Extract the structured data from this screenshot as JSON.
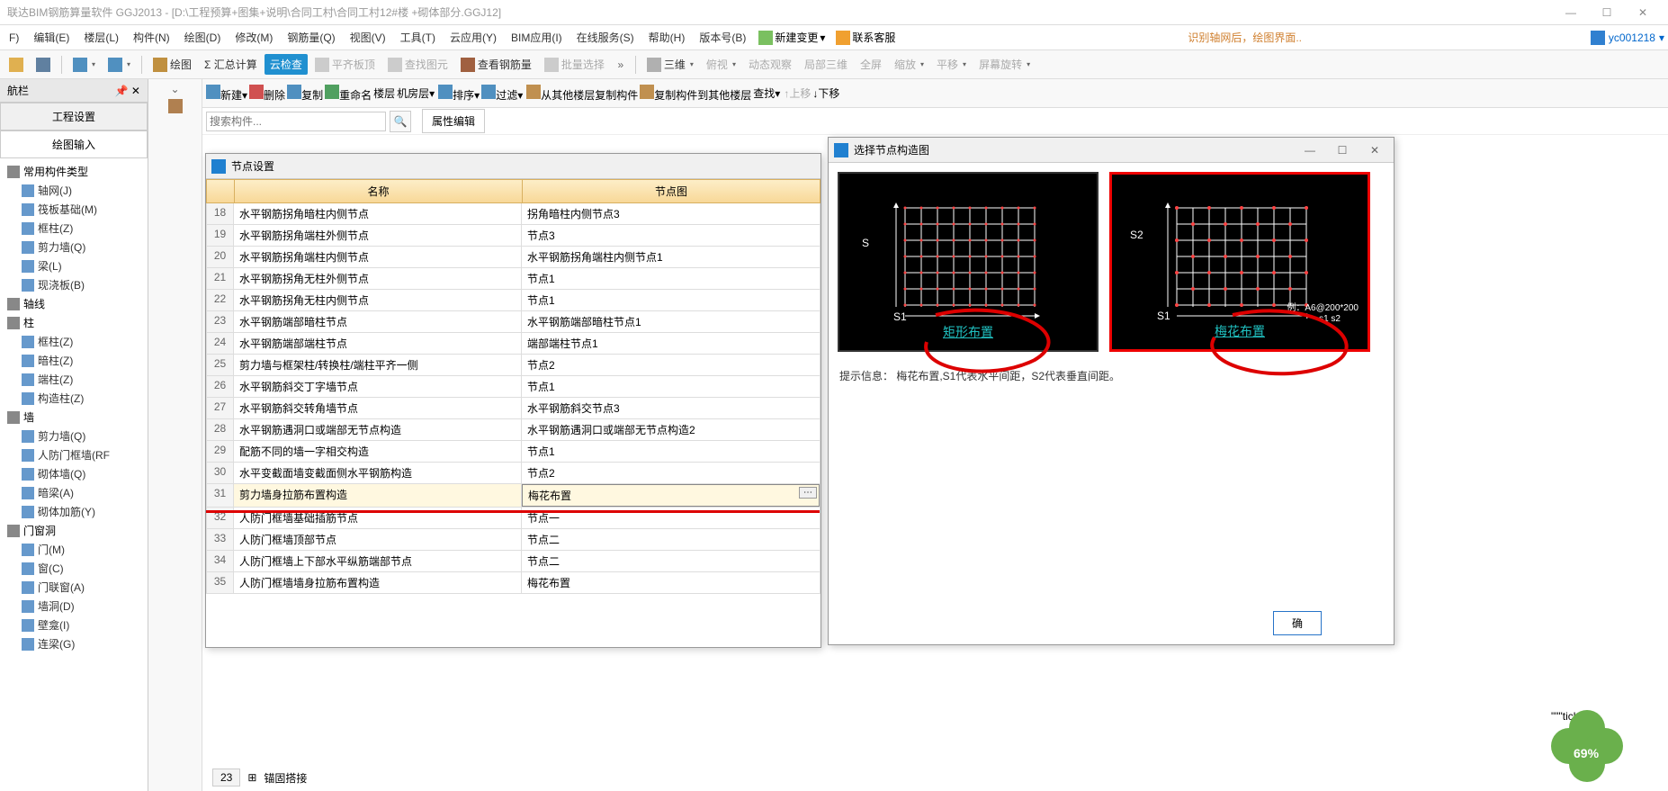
{
  "title": "联达BIM钢筋算量软件 GGJ2013 - [D:\\工程预算+图集+说明\\合同工村\\合同工村12#楼 +砌体部分.GGJ12]",
  "winbtns": {
    "min": "—",
    "max": "☐",
    "close": "✕"
  },
  "menus": [
    "F)",
    "编辑(E)",
    "楼层(L)",
    "构件(N)",
    "绘图(D)",
    "修改(M)",
    "钢筋量(Q)",
    "视图(V)",
    "工具(T)",
    "云应用(Y)",
    "BIM应用(I)",
    "在线服务(S)",
    "帮助(H)",
    "版本号(B)"
  ],
  "menuright": {
    "newchange": "新建变更",
    "contact": "联系客服",
    "hint": "识别轴网后，绘图界面..",
    "user": "yc001218"
  },
  "tb1": {
    "draw": "绘图",
    "sum": "Σ 汇总计算",
    "cloud": "云检查",
    "flat": "平齐板顶",
    "viewgrid": "查找图元",
    "viewrebar": "查看钢筋量",
    "batch": "批量选择",
    "three": "三维",
    "bird": "俯视",
    "dyn": "动态观察",
    "part3d": "局部三维",
    "full": "全屏",
    "zoom": "缩放",
    "pan": "平移",
    "rot": "屏幕旋转"
  },
  "nav": {
    "title": "航栏",
    "tab1": "工程设置",
    "tab2": "绘图输入",
    "groups": [
      {
        "g": "常用构件类型",
        "items": [
          "轴网(J)",
          "筏板基础(M)",
          "框柱(Z)",
          "剪力墙(Q)",
          "梁(L)",
          "现浇板(B)"
        ]
      },
      {
        "g": "轴线",
        "items": []
      },
      {
        "g": "柱",
        "items": [
          "框柱(Z)",
          "暗柱(Z)",
          "端柱(Z)",
          "构造柱(Z)"
        ]
      },
      {
        "g": "墙",
        "items": [
          "剪力墙(Q)",
          "人防门框墙(RF",
          "砌体墙(Q)",
          "暗梁(A)",
          "砌体加筋(Y)"
        ]
      },
      {
        "g": "门窗洞",
        "items": [
          "门(M)",
          "窗(C)",
          "门联窗(A)",
          "墙洞(D)",
          "壁龛(I)",
          "连梁(G)"
        ]
      }
    ]
  },
  "tb2": {
    "new": "新建",
    "del": "删除",
    "copy": "复制",
    "rename": "重命名",
    "floor": "楼层",
    "machine": "机房层",
    "sort": "排序",
    "filter": "过滤",
    "copyfrom": "从其他楼层复制构件",
    "copyto": "复制构件到其他楼层",
    "find": "查找",
    "up": "上移",
    "down": "下移"
  },
  "search": {
    "ph": "搜索构件..."
  },
  "proptab": "属性编辑",
  "nodedlg": {
    "title": "节点设置",
    "h1": "名称",
    "h2": "节点图",
    "rows": [
      {
        "n": 18,
        "a": "水平钢筋拐角暗柱内侧节点",
        "b": "拐角暗柱内侧节点3"
      },
      {
        "n": 19,
        "a": "水平钢筋拐角端柱外侧节点",
        "b": "节点3"
      },
      {
        "n": 20,
        "a": "水平钢筋拐角端柱内侧节点",
        "b": "水平钢筋拐角端柱内侧节点1"
      },
      {
        "n": 21,
        "a": "水平钢筋拐角无柱外侧节点",
        "b": "节点1"
      },
      {
        "n": 22,
        "a": "水平钢筋拐角无柱内侧节点",
        "b": "节点1"
      },
      {
        "n": 23,
        "a": "水平钢筋端部暗柱节点",
        "b": "水平钢筋端部暗柱节点1"
      },
      {
        "n": 24,
        "a": "水平钢筋端部端柱节点",
        "b": "端部端柱节点1"
      },
      {
        "n": 25,
        "a": "剪力墙与框架柱/转换柱/端柱平齐一侧",
        "b": "节点2"
      },
      {
        "n": 26,
        "a": "水平钢筋斜交丁字墙节点",
        "b": "节点1"
      },
      {
        "n": 27,
        "a": "水平钢筋斜交转角墙节点",
        "b": "水平钢筋斜交节点3"
      },
      {
        "n": 28,
        "a": "水平钢筋遇洞口或端部无节点构造",
        "b": "水平钢筋遇洞口或端部无节点构造2"
      },
      {
        "n": 29,
        "a": "配筋不同的墙一字相交构造",
        "b": "节点1"
      },
      {
        "n": 30,
        "a": "水平变截面墙变截面侧水平钢筋构造",
        "b": "节点2"
      },
      {
        "n": 31,
        "a": "剪力墙身拉筋布置构造",
        "b": "梅花布置",
        "sel": true
      },
      {
        "n": 32,
        "a": "人防门框墙基础插筋节点",
        "b": "节点一"
      },
      {
        "n": 33,
        "a": "人防门框墙顶部节点",
        "b": "节点二"
      },
      {
        "n": 34,
        "a": "人防门框墙上下部水平纵筋端部节点",
        "b": "节点二"
      },
      {
        "n": 35,
        "a": "人防门框墙墙身拉筋布置构造",
        "b": "梅花布置"
      }
    ]
  },
  "footer": {
    "n": "23",
    "t": "锚固搭接"
  },
  "choice": {
    "title": "选择节点构造图",
    "opt1": "矩形布置",
    "opt2": "梅花布置",
    "s1": "S1",
    "s2": "S2",
    "s": "S",
    "ex": "例：A6@200*200",
    "ss": "s1  s2",
    "hint": "提示信息： 梅花布置,S1代表水平间距，S2代表垂直间距。",
    "ok": "确"
  },
  "clover": "69%"
}
